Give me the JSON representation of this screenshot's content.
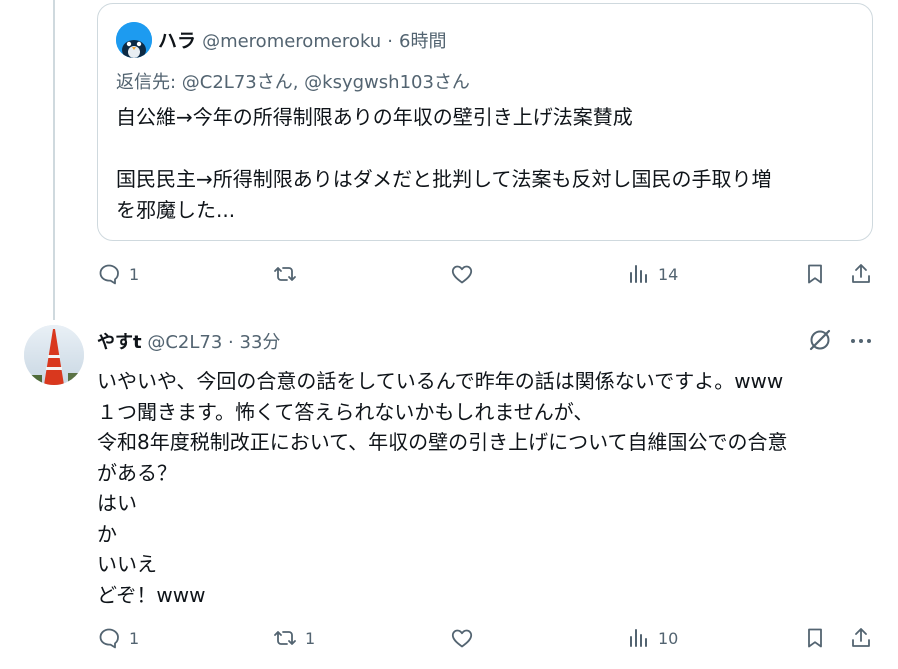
{
  "quoted": {
    "name": "ハラ",
    "handle": "@meromeromeroku",
    "time": "6時間",
    "reply_to": "返信先: @C2L73さん, @ksygwsh103さん",
    "line1": "自公維→今年の所得制限ありの年収の壁引き上げ法案賛成",
    "line2": "国民民主→所得制限ありはダメだと批判して法案も反対し国民の手取り増",
    "line3": "を邪魔した..."
  },
  "quoted_actions": {
    "replies": "1",
    "reposts": "",
    "likes": "",
    "views": "14"
  },
  "tweet": {
    "name": "やすt",
    "handle": "@C2L73",
    "time": "33分",
    "lines": [
      "いやいや、今回の合意の話をしているんで昨年の話は関係ないですよ。www",
      "１つ聞きます。怖くて答えられないかもしれませんが、",
      "令和8年度税制改正において、年収の壁の引き上げについて自維国公での合意",
      "がある？",
      "はい",
      "か",
      "いいえ",
      "どぞ！www"
    ]
  },
  "tweet_actions": {
    "replies": "1",
    "reposts": "1",
    "likes": "",
    "views": "10"
  },
  "icons": [
    "reply-icon",
    "repost-icon",
    "like-icon",
    "views-icon",
    "bookmark-icon",
    "share-icon",
    "grok-icon",
    "more-icon"
  ],
  "colors": {
    "text": "#0f1419",
    "secondary": "#536471",
    "border": "#cfd9de",
    "avatar_blue": "#1d9bf0"
  }
}
